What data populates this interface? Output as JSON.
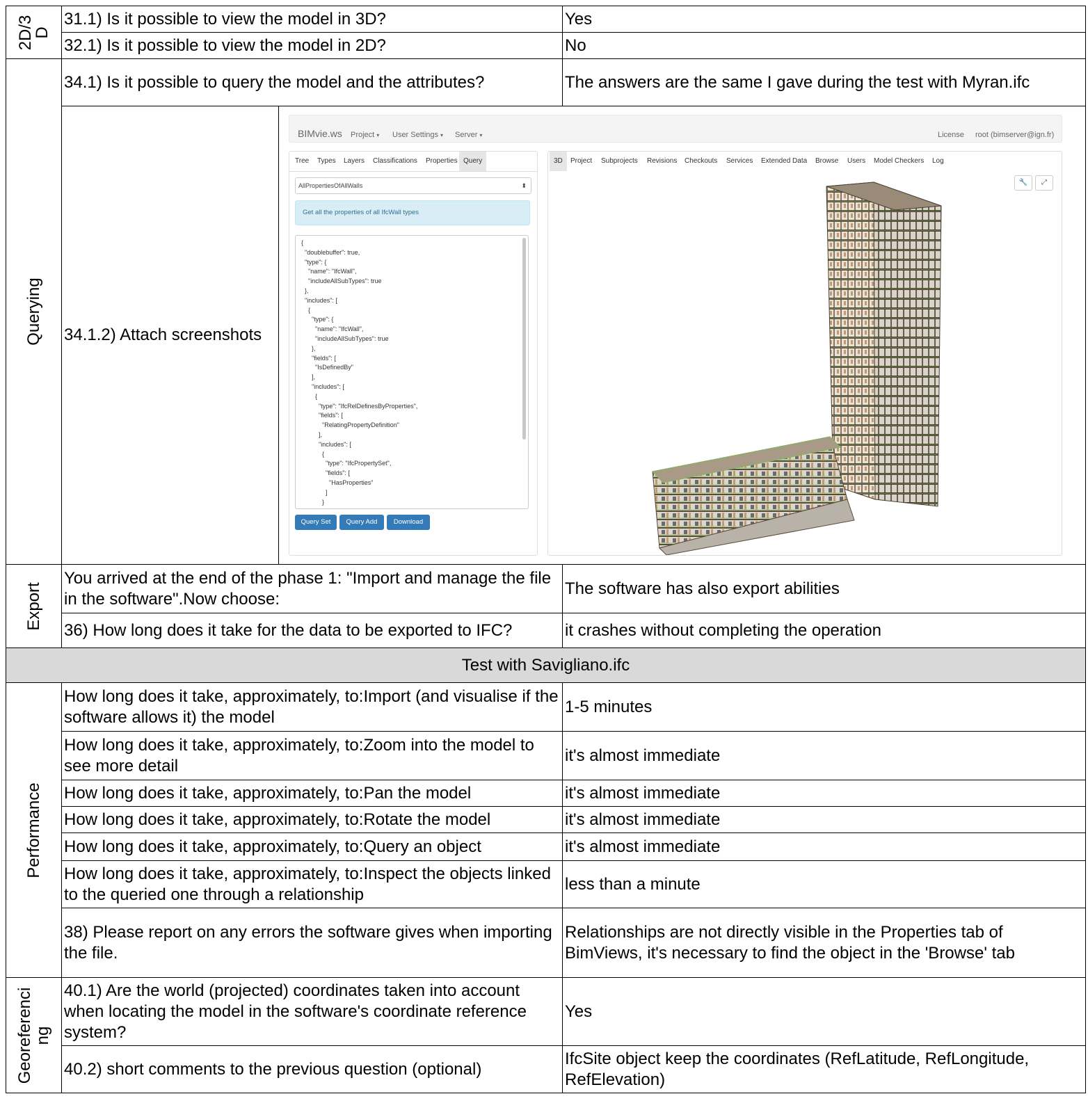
{
  "sections": {
    "d2d3": "2D/3 D",
    "querying": "Querying",
    "export": "Export",
    "performance": "Performance",
    "georef": "Georeferenci ng"
  },
  "rows": {
    "q31": "31.1) Is it possible to view the model in 3D?",
    "a31": "Yes",
    "q32": "32.1) Is it possible to view the model in 2D?",
    "a32": "No",
    "q34": "34.1) Is it possible to query the model and the attributes?",
    "a34": "The answers are the same I gave during the test with Myran.ifc",
    "q3412": "34.1.2) Attach screenshots",
    "qexp": "You arrived at the end of the phase 1: \"Import and manage the file in the software\".Now choose:",
    "aexp": "The software has also export abilities",
    "q36": "36) How long does it take for the data to be exported to IFC?",
    "a36": "it crashes without completing the operation",
    "band": "Test with Savigliano.ifc",
    "p1q": "How long does it take, approximately, to:Import (and visualise if the software allows it) the model",
    "p1a": "1-5 minutes",
    "p2q": "How long does it take, approximately, to:Zoom into the model to see more detail",
    "p2a": "it's almost immediate",
    "p3q": "How long does it take, approximately, to:Pan the model",
    "p3a": "it's almost immediate",
    "p4q": "How long does it take, approximately, to:Rotate the model",
    "p4a": "it's almost immediate",
    "p5q": "How long does it take, approximately, to:Query an object",
    "p5a": "it's almost immediate",
    "p6q": "How long does it take, approximately, to:Inspect the objects linked to the queried one through a relationship",
    "p6a": "less than a minute",
    "q38": "38) Please report on any errors the software gives when importing the file.",
    "a38": "Relationships are not directly visible in the Properties tab of BimViews, it's necessary to find the object in the 'Browse' tab",
    "q401": "40.1) Are the world (projected) coordinates taken into account when locating the model in the software's coordinate reference system?",
    "a401": "Yes",
    "q402": "40.2) short comments to the previous question (optional)",
    "a402": "IfcSite object keep the coordinates (RefLatitude, RefLongitude, RefElevation)"
  },
  "screenshot": {
    "brand": "BIMvie.ws",
    "menu": [
      "Project",
      "User Settings",
      "Server"
    ],
    "license": "License",
    "user": "root (bimserver@ign.fr)",
    "left_tabs": [
      "Tree",
      "Types",
      "Layers",
      "Classifications",
      "Properties",
      "Query"
    ],
    "query_select": "AllPropertiesOfAllWalls",
    "info": "Get all the properties of all IfcWall types",
    "code": "{\n  \"doublebuffer\": true,\n  \"type\": {\n    \"name\": \"IfcWall\",\n    \"includeAllSubTypes\": true\n  },\n  \"includes\": [\n    {\n      \"type\": {\n        \"name\": \"IfcWall\",\n        \"includeAllSubTypes\": true\n      },\n      \"fields\": [\n        \"IsDefinedBy\"\n      ],\n      \"includes\": [\n        {\n          \"type\": \"IfcRelDefinesByProperties\",\n          \"fields\": [\n            \"RelatingPropertyDefinition\"\n          ],\n          \"includes\": [\n            {\n              \"type\": \"IfcPropertySet\",\n              \"fields\": [\n                \"HasProperties\"\n              ]\n            }",
    "buttons": [
      "Query Set",
      "Query Add",
      "Download"
    ],
    "right_tabs": [
      "3D",
      "Project",
      "Subprojects",
      "Revisions",
      "Checkouts",
      "Services",
      "Extended Data",
      "Browse",
      "Users",
      "Model Checkers",
      "Log"
    ],
    "colors": {
      "primary": "#337ab7",
      "info_bg": "#d9edf7",
      "building_frame": "#5a4a3a",
      "building_accent": "#7dbb5a"
    }
  }
}
